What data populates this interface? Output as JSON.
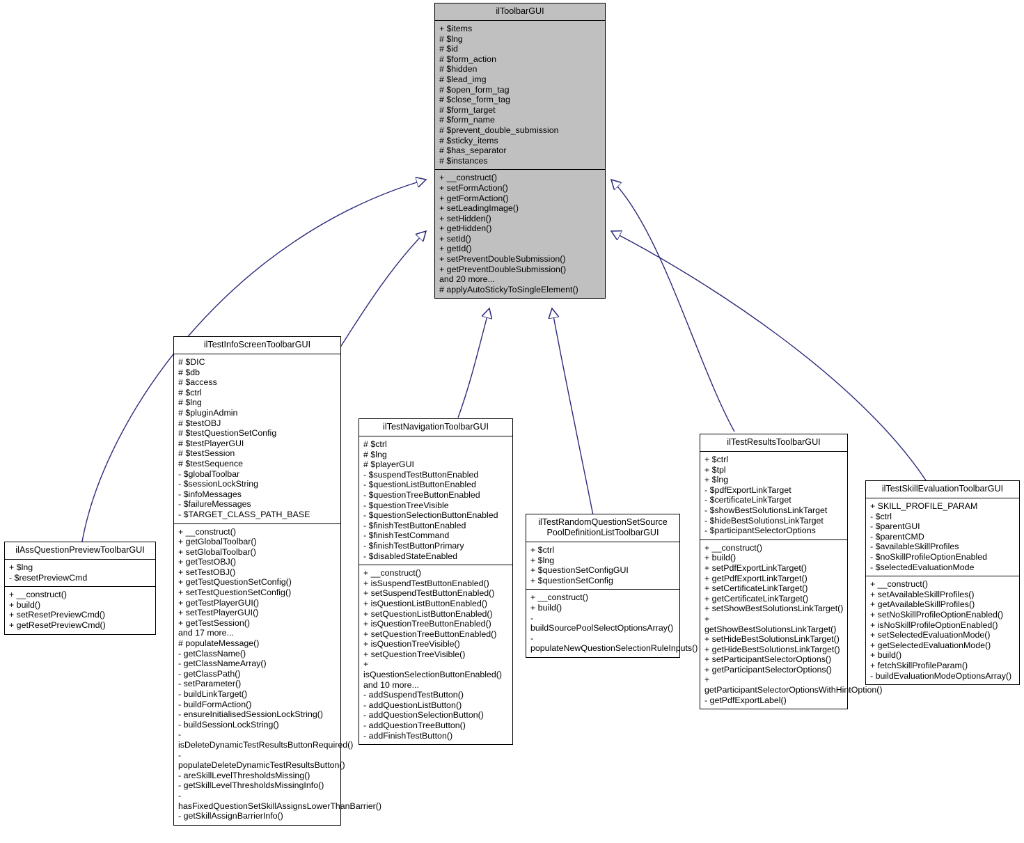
{
  "diagram": {
    "type": "uml-class-inheritance",
    "edge_color": "#2a2a7a",
    "base_fill": "#c0c0c0",
    "class_fill": "#ffffff",
    "border_color": "#000000"
  },
  "classes": {
    "toolbar": {
      "name": "ilToolbarGUI",
      "attributes": [
        "+ $items",
        "# $lng",
        "# $id",
        "# $form_action",
        "# $hidden",
        "# $lead_img",
        "# $open_form_tag",
        "# $close_form_tag",
        "# $form_target",
        "# $form_name",
        "# $prevent_double_submission",
        "# $sticky_items",
        "# $has_separator",
        "# $instances"
      ],
      "methods": [
        "+ __construct()",
        "+ setFormAction()",
        "+ getFormAction()",
        "+ setLeadingImage()",
        "+ setHidden()",
        "+ getHidden()",
        "+ setId()",
        "+ getId()",
        "+ setPreventDoubleSubmission()",
        "+ getPreventDoubleSubmission()",
        "and 20 more...",
        "# applyAutoStickyToSingleElement()"
      ]
    },
    "assQuestionPreview": {
      "name": "ilAssQuestionPreviewToolbarGUI",
      "attributes": [
        "+ $lng",
        "- $resetPreviewCmd"
      ],
      "methods": [
        "+ __construct()",
        "+ build()",
        "+ setResetPreviewCmd()",
        "+ getResetPreviewCmd()"
      ]
    },
    "infoScreen": {
      "name": "ilTestInfoScreenToolbarGUI",
      "attributes": [
        "# $DIC",
        "# $db",
        "# $access",
        "# $ctrl",
        "# $lng",
        "# $pluginAdmin",
        "# $testOBJ",
        "# $testQuestionSetConfig",
        "# $testPlayerGUI",
        "# $testSession",
        "# $testSequence",
        "- $globalToolbar",
        "- $sessionLockString",
        "- $infoMessages",
        "- $failureMessages",
        "- $TARGET_CLASS_PATH_BASE"
      ],
      "methods": [
        "+ __construct()",
        "+ getGlobalToolbar()",
        "+ setGlobalToolbar()",
        "+ getTestOBJ()",
        "+ setTestOBJ()",
        "+ getTestQuestionSetConfig()",
        "+ setTestQuestionSetConfig()",
        "+ getTestPlayerGUI()",
        "+ setTestPlayerGUI()",
        "+ getTestSession()",
        "and 17 more...",
        "# populateMessage()",
        "- getClassName()",
        "- getClassNameArray()",
        "- getClassPath()",
        "- setParameter()",
        "- buildLinkTarget()",
        "- buildFormAction()",
        "- ensureInitialisedSessionLockString()",
        "- buildSessionLockString()",
        "- isDeleteDynamicTestResultsButtonRequired()",
        "- populateDeleteDynamicTestResultsButton()",
        "- areSkillLevelThresholdsMissing()",
        "- getSkillLevelThresholdsMissingInfo()",
        "- hasFixedQuestionSetSkillAssignsLowerThanBarrier()",
        "- getSkillAssignBarrierInfo()"
      ]
    },
    "navigation": {
      "name": "ilTestNavigationToolbarGUI",
      "attributes": [
        "# $ctrl",
        "# $lng",
        "# $playerGUI",
        "- $suspendTestButtonEnabled",
        "- $questionListButtonEnabled",
        "- $questionTreeButtonEnabled",
        "- $questionTreeVisible",
        "- $questionSelectionButtonEnabled",
        "- $finishTestButtonEnabled",
        "- $finishTestCommand",
        "- $finishTestButtonPrimary",
        "- $disabledStateEnabled"
      ],
      "methods": [
        "+ __construct()",
        "+ isSuspendTestButtonEnabled()",
        "+ setSuspendTestButtonEnabled()",
        "+ isQuestionListButtonEnabled()",
        "+ setQuestionListButtonEnabled()",
        "+ isQuestionTreeButtonEnabled()",
        "+ setQuestionTreeButtonEnabled()",
        "+ isQuestionTreeVisible()",
        "+ setQuestionTreeVisible()",
        "+ isQuestionSelectionButtonEnabled()",
        "and 10 more...",
        "- addSuspendTestButton()",
        "- addQuestionListButton()",
        "- addQuestionSelectionButton()",
        "- addQuestionTreeButton()",
        "- addFinishTestButton()"
      ]
    },
    "randomQuestionSet": {
      "name": "ilTestRandomQuestionSetSource\nPoolDefinitionListToolbarGUI",
      "attributes": [
        "+ $ctrl",
        "+ $lng",
        "+ $questionSetConfigGUI",
        "+ $questionSetConfig"
      ],
      "methods": [
        "+ __construct()",
        "+ build()",
        "- buildSourcePoolSelectOptionsArray()",
        "- populateNewQuestionSelectionRuleInputs()"
      ]
    },
    "results": {
      "name": "ilTestResultsToolbarGUI",
      "attributes": [
        "+ $ctrl",
        "+ $tpl",
        "+ $lng",
        "- $pdfExportLinkTarget",
        "- $certificateLinkTarget",
        "- $showBestSolutionsLinkTarget",
        "- $hideBestSolutionsLinkTarget",
        "- $participantSelectorOptions"
      ],
      "methods": [
        "+ __construct()",
        "+ build()",
        "+ setPdfExportLinkTarget()",
        "+ getPdfExportLinkTarget()",
        "+ setCertificateLinkTarget()",
        "+ getCertificateLinkTarget()",
        "+ setShowBestSolutionsLinkTarget()",
        "+ getShowBestSolutionsLinkTarget()",
        "+ setHideBestSolutionsLinkTarget()",
        "+ getHideBestSolutionsLinkTarget()",
        "+ setParticipantSelectorOptions()",
        "+ getParticipantSelectorOptions()",
        "+ getParticipantSelectorOptionsWithHintOption()",
        "- getPdfExportLabel()"
      ]
    },
    "skillEvaluation": {
      "name": "ilTestSkillEvaluationToolbarGUI",
      "attributes": [
        "+ SKILL_PROFILE_PARAM",
        "- $ctrl",
        "- $parentGUI",
        "- $parentCMD",
        "- $availableSkillProfiles",
        "- $noSkillProfileOptionEnabled",
        "- $selectedEvaluationMode"
      ],
      "methods": [
        "+ __construct()",
        "+ setAvailableSkillProfiles()",
        "+ getAvailableSkillProfiles()",
        "+ setNoSkillProfileOptionEnabled()",
        "+ isNoSkillProfileOptionEnabled()",
        "+ setSelectedEvaluationMode()",
        "+ getSelectedEvaluationMode()",
        "+ build()",
        "+ fetchSkillProfileParam()",
        "- buildEvaluationModeOptionsArray()"
      ]
    }
  },
  "inheritance_edges": [
    {
      "from": "ilAssQuestionPreviewToolbarGUI",
      "to": "ilToolbarGUI"
    },
    {
      "from": "ilTestInfoScreenToolbarGUI",
      "to": "ilToolbarGUI"
    },
    {
      "from": "ilTestNavigationToolbarGUI",
      "to": "ilToolbarGUI"
    },
    {
      "from": "ilTestRandomQuestionSetSourcePoolDefinitionListToolbarGUI",
      "to": "ilToolbarGUI"
    },
    {
      "from": "ilTestResultsToolbarGUI",
      "to": "ilToolbarGUI"
    },
    {
      "from": "ilTestSkillEvaluationToolbarGUI",
      "to": "ilToolbarGUI"
    }
  ]
}
